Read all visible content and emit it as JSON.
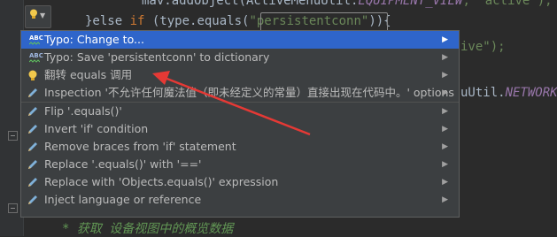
{
  "editor": {
    "line1": "mav.addObject(ActiveMenuUtil.",
    "line1_field": "EQUIPMENT_VIEW",
    "line1_tail": ", \"active\");",
    "line2_pre": "}else ",
    "line2_kw": "if",
    "line2_mid": " (type.equals(",
    "line2_str": "\"persistentconn\"",
    "line2_post": ")){",
    "line3_tail": "ive\");",
    "line4_tail": "uUtil.",
    "line4_field": "NETWORK",
    "comment": "* 获取 设备视图中的概览数据"
  },
  "menu": {
    "items": [
      {
        "label": "Typo: Change to...",
        "icon": "typo-icon",
        "arrow": "▶",
        "selected": true
      },
      {
        "label": "Typo: Save 'persistentconn' to dictionary",
        "icon": "typo-icon",
        "arrow": "▶"
      },
      {
        "label": "翻转 equals 调用",
        "icon": "lightbulb-icon",
        "arrow": "▶"
      },
      {
        "label": "Inspection '不允许任何魔法值（即未经定义的常量）直接出现在代码中。' options",
        "icon": "pencil-icon",
        "arrow": "▶"
      },
      {
        "label": "Flip '.equals()'",
        "icon": "pencil-icon",
        "arrow": "▶"
      },
      {
        "label": "Invert 'if' condition",
        "icon": "pencil-icon",
        "arrow": "▶"
      },
      {
        "label": "Remove braces from 'if' statement",
        "icon": "pencil-icon",
        "arrow": "▶"
      },
      {
        "label": "Replace '.equals()' with '=='",
        "icon": "pencil-icon",
        "arrow": "▶"
      },
      {
        "label": "Replace with 'Objects.equals()' expression",
        "icon": "pencil-icon",
        "arrow": "▶"
      },
      {
        "label": "Inject language or reference",
        "icon": "pencil-icon",
        "arrow": "▶"
      }
    ]
  },
  "colors": {
    "editor_bg": "#2b2b2b",
    "menu_bg": "#3c3f41",
    "selection": "#2f65ca",
    "annotation_arrow": "#e53935"
  }
}
